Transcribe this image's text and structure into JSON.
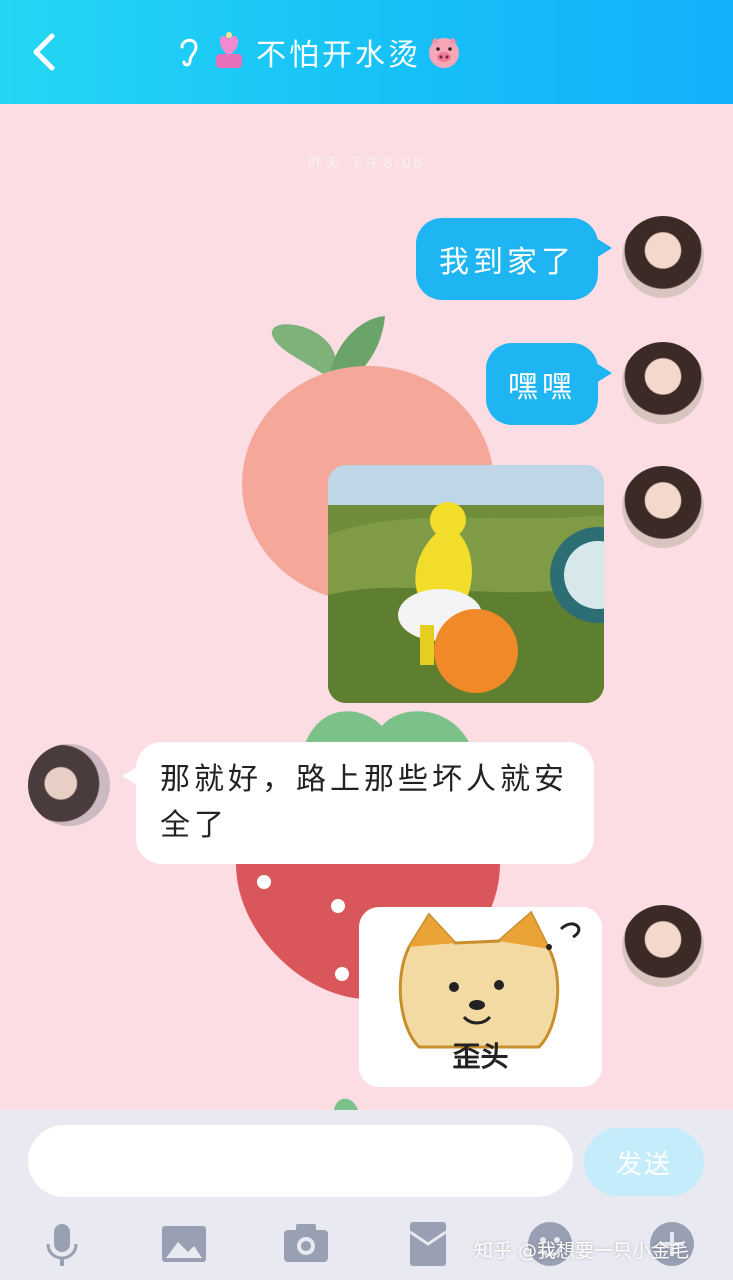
{
  "header": {
    "title": "不怕开水烫"
  },
  "chat": {
    "timestamp": "昨天 下午8:06",
    "messages": [
      {
        "side": "right",
        "type": "text",
        "text": "我到家了"
      },
      {
        "side": "right",
        "type": "text",
        "text": "嘿嘿"
      },
      {
        "side": "right",
        "type": "image",
        "description": "teletubby-dancing-gif"
      },
      {
        "side": "left",
        "type": "text",
        "text": "那就好，路上那些坏人就安全了"
      },
      {
        "side": "right",
        "type": "sticker",
        "caption": "歪头"
      }
    ]
  },
  "composer": {
    "placeholder": "",
    "send_label": "发送"
  },
  "toolbar": {
    "items": [
      "microphone-icon",
      "image-icon",
      "camera-icon",
      "red-packet-icon",
      "emoji-icon",
      "plus-icon"
    ]
  },
  "watermark": "知乎 @我想要一只小金毛",
  "colors": {
    "header_start": "#25d6f3",
    "header_end": "#12b0fb",
    "bubble_blue": "#1fb5f3",
    "background_pink": "#fbdde3"
  }
}
